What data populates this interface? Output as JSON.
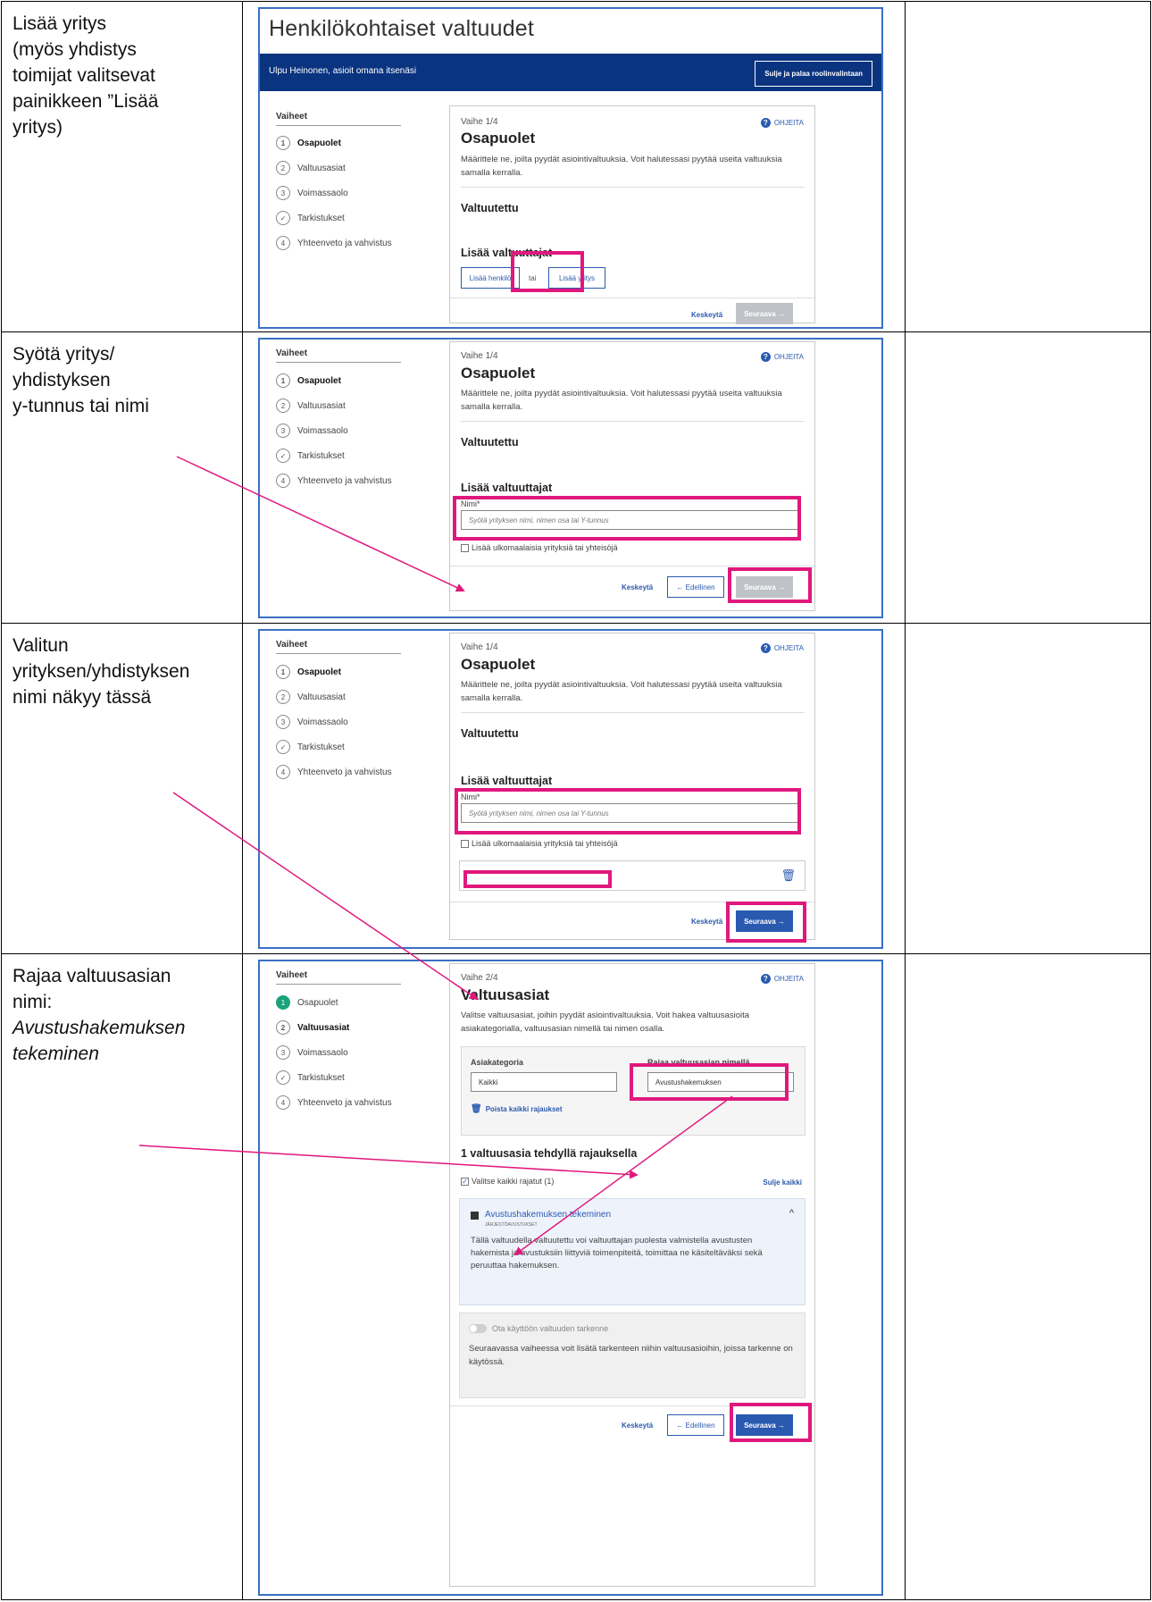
{
  "colors": {
    "accent": "#2a5ab0",
    "banner": "#0a3380",
    "highlight": "#e0187d",
    "done_step": "#1aa37a"
  },
  "rows": [
    {
      "caption": "Lisää yritys\n(myös yhdistys\ntoimijat valitsevat\npainikkeen ”Lisää\nyritys)"
    },
    {
      "caption": "Syötä yritys/\nyhdistyksen\ny-tunnus tai nimi"
    },
    {
      "caption": "Valitun\nyrityksen/yhdistyksen\nnimi näkyy tässä"
    },
    {
      "caption_plain": "Rajaa valtuusasian\nnimi:",
      "caption_italic": "Avustushakemuksen\ntekeminen"
    }
  ],
  "shot1": {
    "page_title": "Henkilökohtaiset valtuudet",
    "banner_text": "Ulpu Heinonen, asioit omana itsenäsi",
    "banner_button": "Sulje ja palaa roolinvalintaan"
  },
  "steps": {
    "heading": "Vaiheet",
    "items": [
      {
        "num": "1",
        "label": "Osapuolet"
      },
      {
        "num": "2",
        "label": "Valtuusasiat"
      },
      {
        "num": "3",
        "label": "Voimassaolo"
      },
      {
        "num": "✓",
        "label": "Tarkistukset"
      },
      {
        "num": "4",
        "label": "Yhteenveto ja vahvistus"
      }
    ]
  },
  "card": {
    "help": "OHJEITA",
    "step1_label": "Vaihe 1/4",
    "step1_title": "Osapuolet",
    "step1_desc": "Määrittele ne, joilta pyydät asiointivaltuuksia. Voit halutessasi pyytää useita valtuuksia samalla kerralla.",
    "valtuutettu": "Valtuutettu",
    "lisaa_valtuuttajat": "Lisää valtuuttajat",
    "add_person": "Lisää henkilö",
    "or": "tai",
    "add_company": "Lisää yritys",
    "name_label": "Nimi*",
    "name_placeholder": "Syötä yrityksen nimi, nimen osa tai Y-tunnus",
    "foreign_checkbox": "Lisää ulkomaalaisia yrityksiä tai yhteisöjä",
    "cancel": "Keskeytä",
    "previous": "← Edellinen",
    "next": "Seuraava →",
    "step2_label": "Vaihe 2/4",
    "step2_title": "Valtuusasiat",
    "step2_desc": "Valitse valtuusasiat, joihin pyydät asiointivaltuuksia. Voit hakea valtuusasioita asiakategorialla, valtuusasian nimellä tai nimen osalla.",
    "category_label": "Asiakategoria",
    "category_value": "Kaikki",
    "filter_label": "Rajaa valtuusasian nimellä",
    "filter_value": "Avustushakemuksen",
    "remove_filters": "Poista kaikki rajaukset",
    "results_heading": "1 valtuusasia tehdyllä rajauksella",
    "select_all": "Valitse kaikki rajatut (1)",
    "close_all": "Sulje kaikki",
    "item_title": "Avustushakemuksen tekeminen",
    "item_category": "JÄRJESTÖAVUSTUKSET",
    "item_desc": "Tällä valtuudella valtuutettu voi valtuuttajan puolesta valmistella avustusten hakemista ja avustuksiin liittyviä toimenpiteitä, toimittaa ne käsiteltäväksi sekä peruuttaa hakemuksen.",
    "toggle_label": "Ota käyttöön valtuuden tarkenne",
    "toggle_desc": "Seuraavassa vaiheessa voit lisätä tarkenteen niihin valtuusasioihin, joissa tarkenne on käytössä."
  }
}
